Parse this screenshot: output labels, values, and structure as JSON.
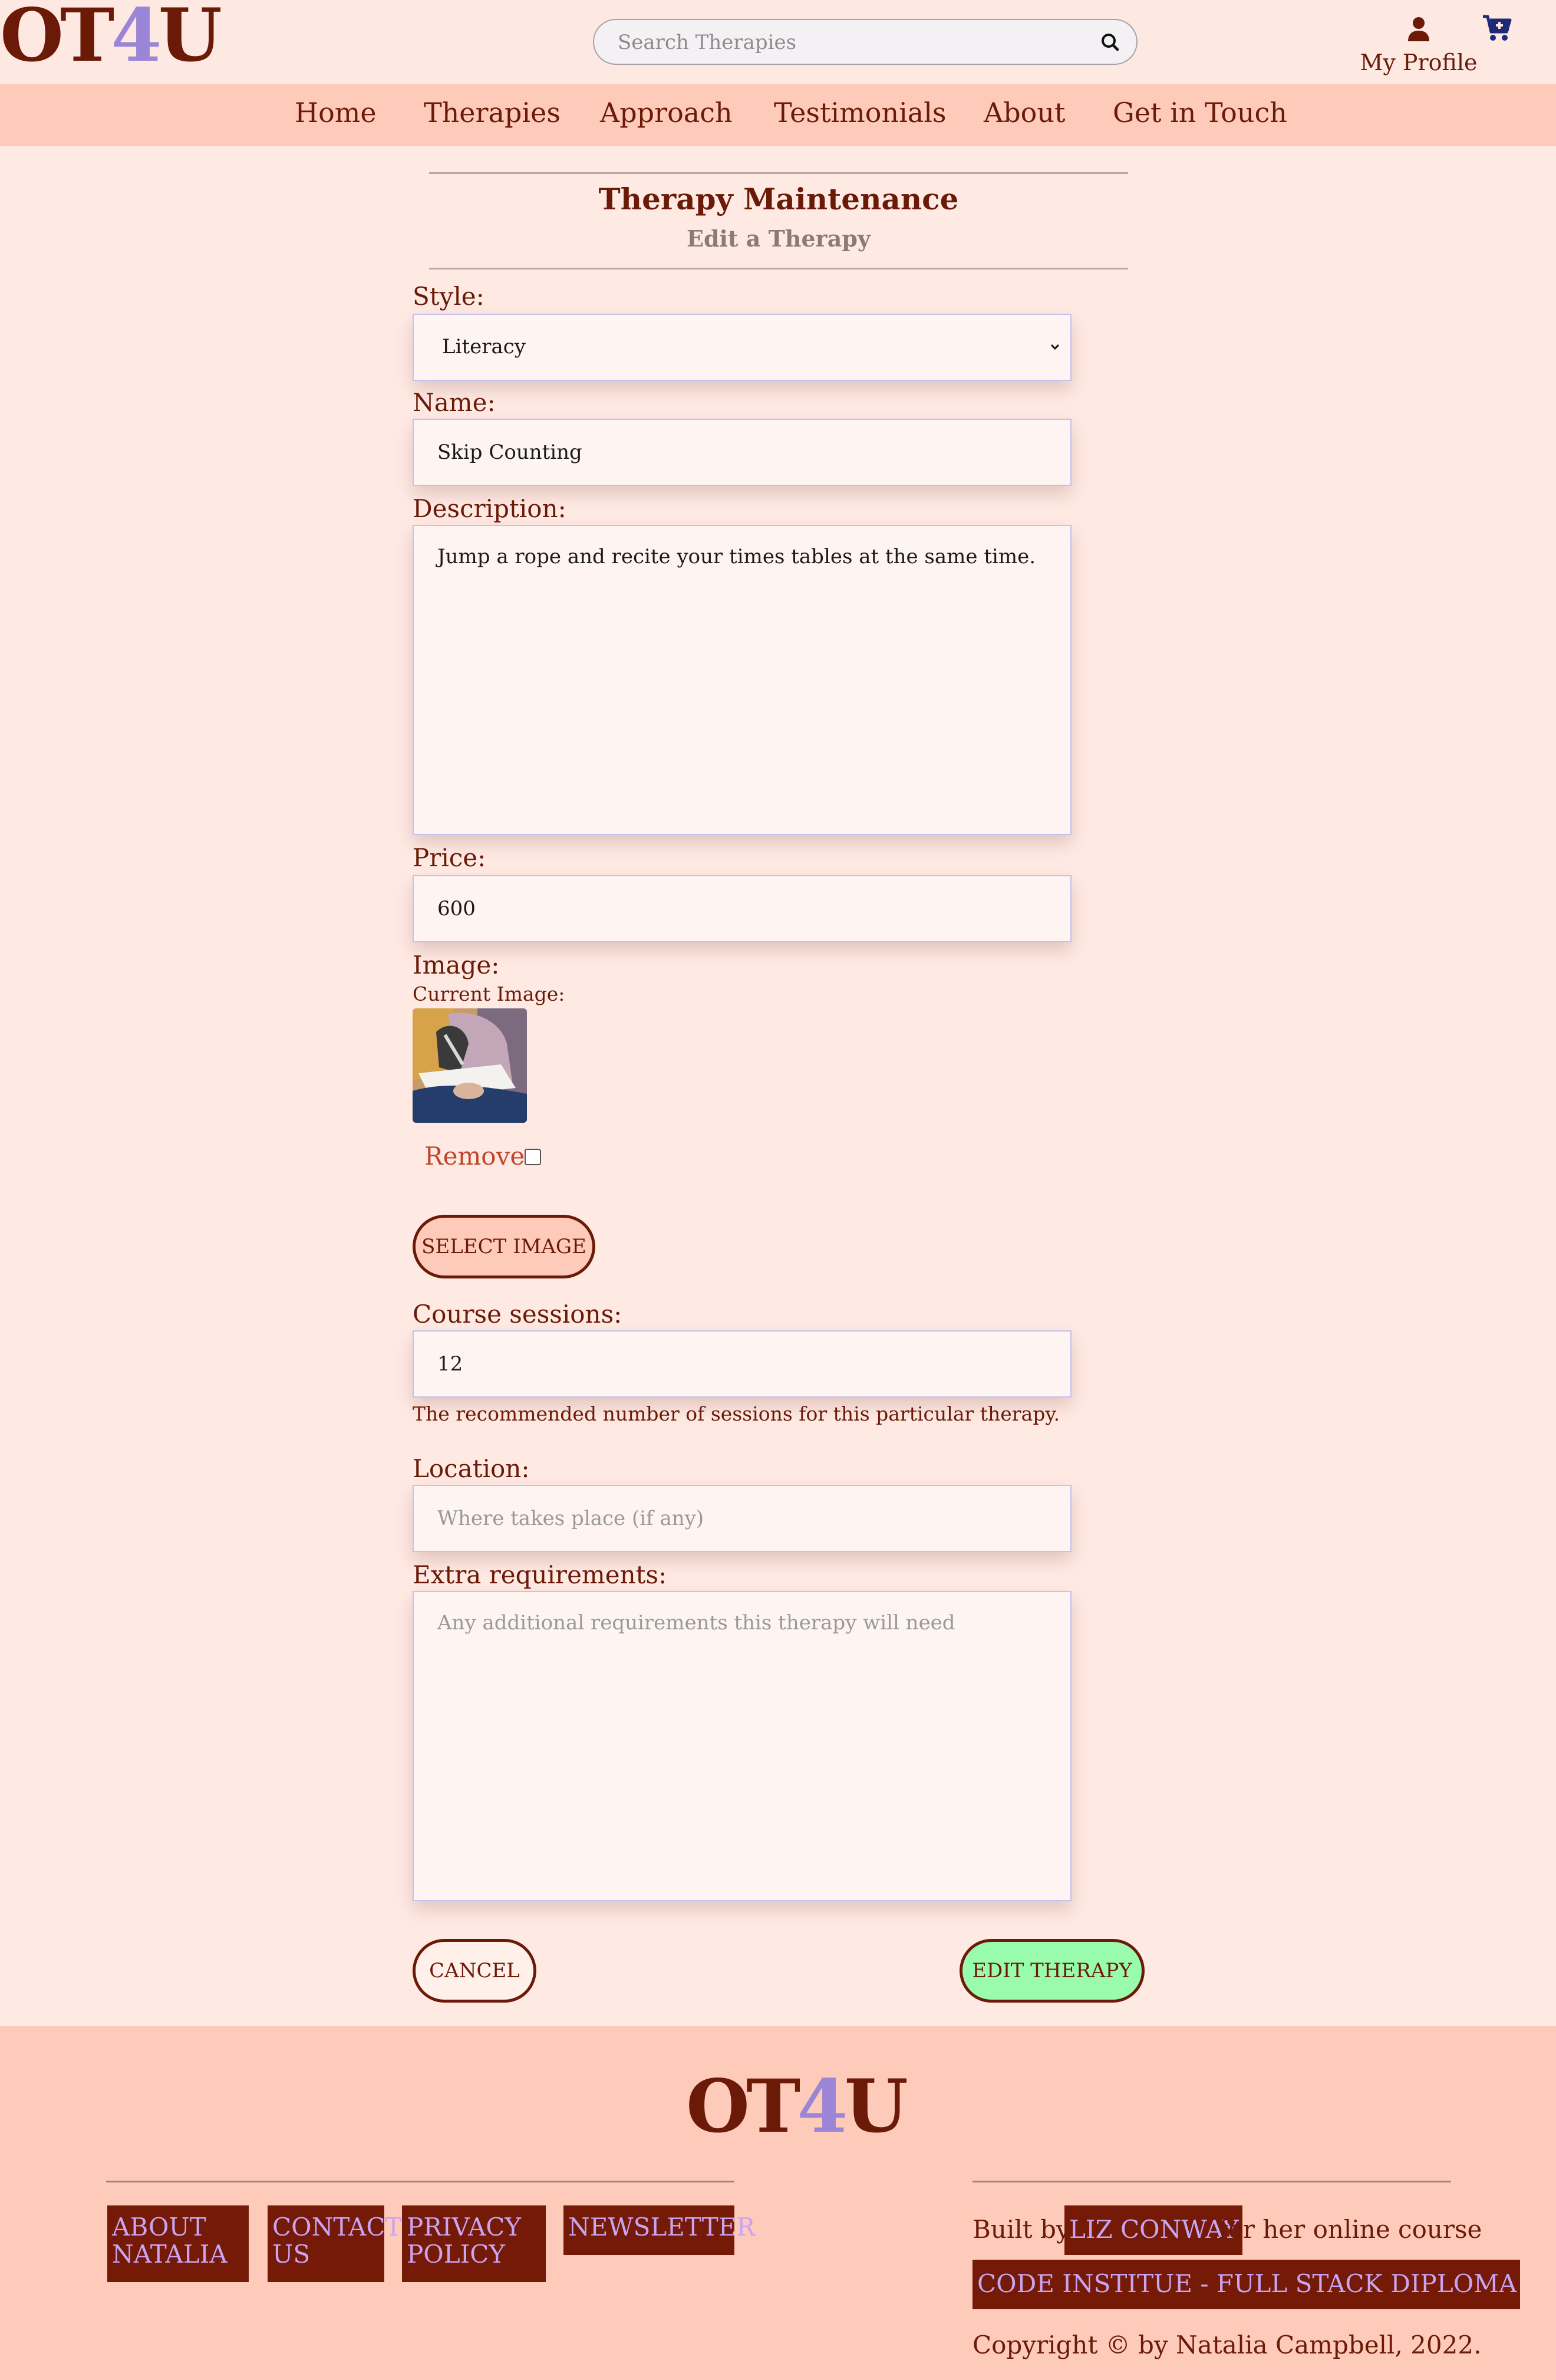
{
  "header": {
    "logo": {
      "pre": "OT",
      "four": "4",
      "post": "U"
    },
    "search_placeholder": "Search Therapies",
    "profile_label": "My Profile"
  },
  "nav": {
    "items": [
      "Home",
      "Therapies",
      "Approach",
      "Testimonials",
      "About",
      "Get in Touch"
    ]
  },
  "form": {
    "title": "Therapy Maintenance",
    "subtitle": "Edit a Therapy",
    "style": {
      "label": "Style:",
      "value": "Literacy"
    },
    "name": {
      "label": "Name:",
      "value": "Skip Counting"
    },
    "description": {
      "label": "Description:",
      "value": "Jump a rope and recite your times tables at the same time."
    },
    "price": {
      "label": "Price:",
      "value": "600"
    },
    "image": {
      "label": "Image:",
      "current_label": "Current Image:",
      "remove_label": "Remove",
      "select_button": "SELECT IMAGE"
    },
    "sessions": {
      "label": "Course sessions:",
      "value": "12",
      "help": "The recommended number of sessions for this particular therapy."
    },
    "location": {
      "label": "Location:",
      "value": "",
      "placeholder": "Where takes place (if any)"
    },
    "extra": {
      "label": "Extra requirements:",
      "value": "",
      "placeholder": "Any additional requirements this therapy will need"
    },
    "cancel_button": "CANCEL",
    "submit_button": "EDIT THERAPY"
  },
  "footer": {
    "logo": {
      "pre": "OT",
      "four": "4",
      "post": "U"
    },
    "links": [
      {
        "line1": "ABOUT",
        "line2": "NATALIA"
      },
      {
        "line1": "CONTACT",
        "line2": "US"
      },
      {
        "line1": "PRIVACY",
        "line2": "POLICY"
      },
      {
        "line1": "NEWSLETTER",
        "line2": ""
      }
    ],
    "built_by": "Built by",
    "author": "LIZ CONWAY",
    "course_text": "for her online course",
    "course_link": "CODE INSTITUE - FULL STACK DIPLOMA",
    "period": ".",
    "copyright": "Copyright © by Natalia Campbell, 2022."
  },
  "colors": {
    "primary": "#6b1a08",
    "nav_bg": "#fecab9",
    "page_bg": "#ffeae3",
    "accent": "#9b85d6",
    "submit_bg": "#98fbae",
    "select_btn_bg": "#fecab9",
    "link_bg": "#741a06",
    "link_text": "#c9a4f2"
  }
}
